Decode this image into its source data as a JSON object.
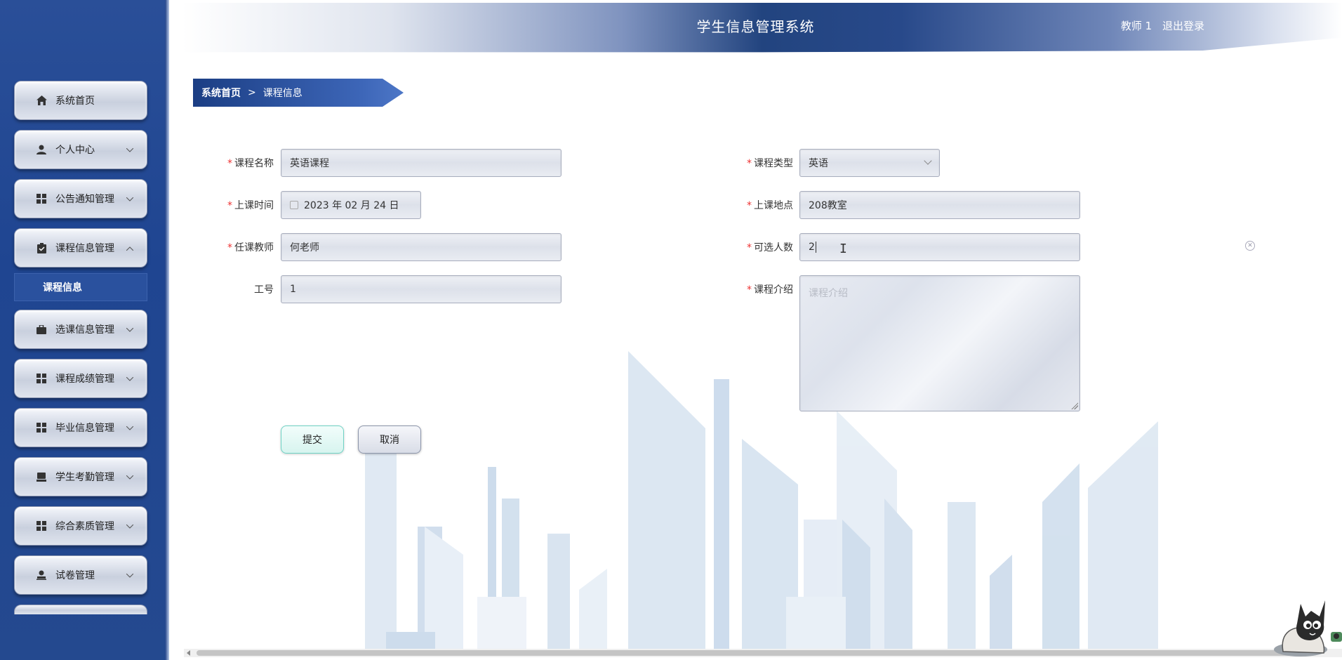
{
  "header": {
    "title": "学生信息管理系统",
    "user": "教师 1",
    "logout": "退出登录"
  },
  "sidebar": {
    "items": [
      {
        "label": "系统首页",
        "icon": "home-icon",
        "arrow": ""
      },
      {
        "label": "个人中心",
        "icon": "user-icon",
        "arrow": "chevron-down"
      },
      {
        "label": "公告通知管理",
        "icon": "grid-icon",
        "arrow": "chevron-down"
      },
      {
        "label": "课程信息管理",
        "icon": "clipboard-icon",
        "arrow": "chevron-up"
      },
      {
        "label": "选课信息管理",
        "icon": "briefcase-icon",
        "arrow": "chevron-down"
      },
      {
        "label": "课程成绩管理",
        "icon": "grid-icon",
        "arrow": "chevron-down"
      },
      {
        "label": "毕业信息管理",
        "icon": "grid-icon",
        "arrow": "chevron-down"
      },
      {
        "label": "学生考勤管理",
        "icon": "monitor-icon",
        "arrow": "chevron-down"
      },
      {
        "label": "综合素质管理",
        "icon": "grid-icon",
        "arrow": "chevron-down"
      },
      {
        "label": "试卷管理",
        "icon": "user-card-icon",
        "arrow": "chevron-down"
      }
    ],
    "submenu": {
      "label": "课程信息"
    }
  },
  "breadcrumb": {
    "home": "系统首页",
    "separator": ">",
    "current": "课程信息"
  },
  "form": {
    "course_name": {
      "label": "课程名称",
      "value": "英语课程"
    },
    "course_type": {
      "label": "课程类型",
      "value": "英语"
    },
    "class_time": {
      "label": "上课时间",
      "value": "2023 年 02 月 24 日"
    },
    "class_location": {
      "label": "上课地点",
      "value": "208教室"
    },
    "teacher": {
      "label": "任课教师",
      "value": "何老师"
    },
    "capacity": {
      "label": "可选人数",
      "value": "2"
    },
    "staff_id": {
      "label": "工号",
      "value": "1"
    },
    "intro": {
      "label": "课程介绍",
      "placeholder": "课程介绍",
      "value": ""
    },
    "submit": "提交",
    "cancel": "取消"
  },
  "colors": {
    "sidebar_bg": "#24498f",
    "header_center": "#22447f",
    "required": "#ee3333",
    "submit_border": "#6fd3c5"
  }
}
